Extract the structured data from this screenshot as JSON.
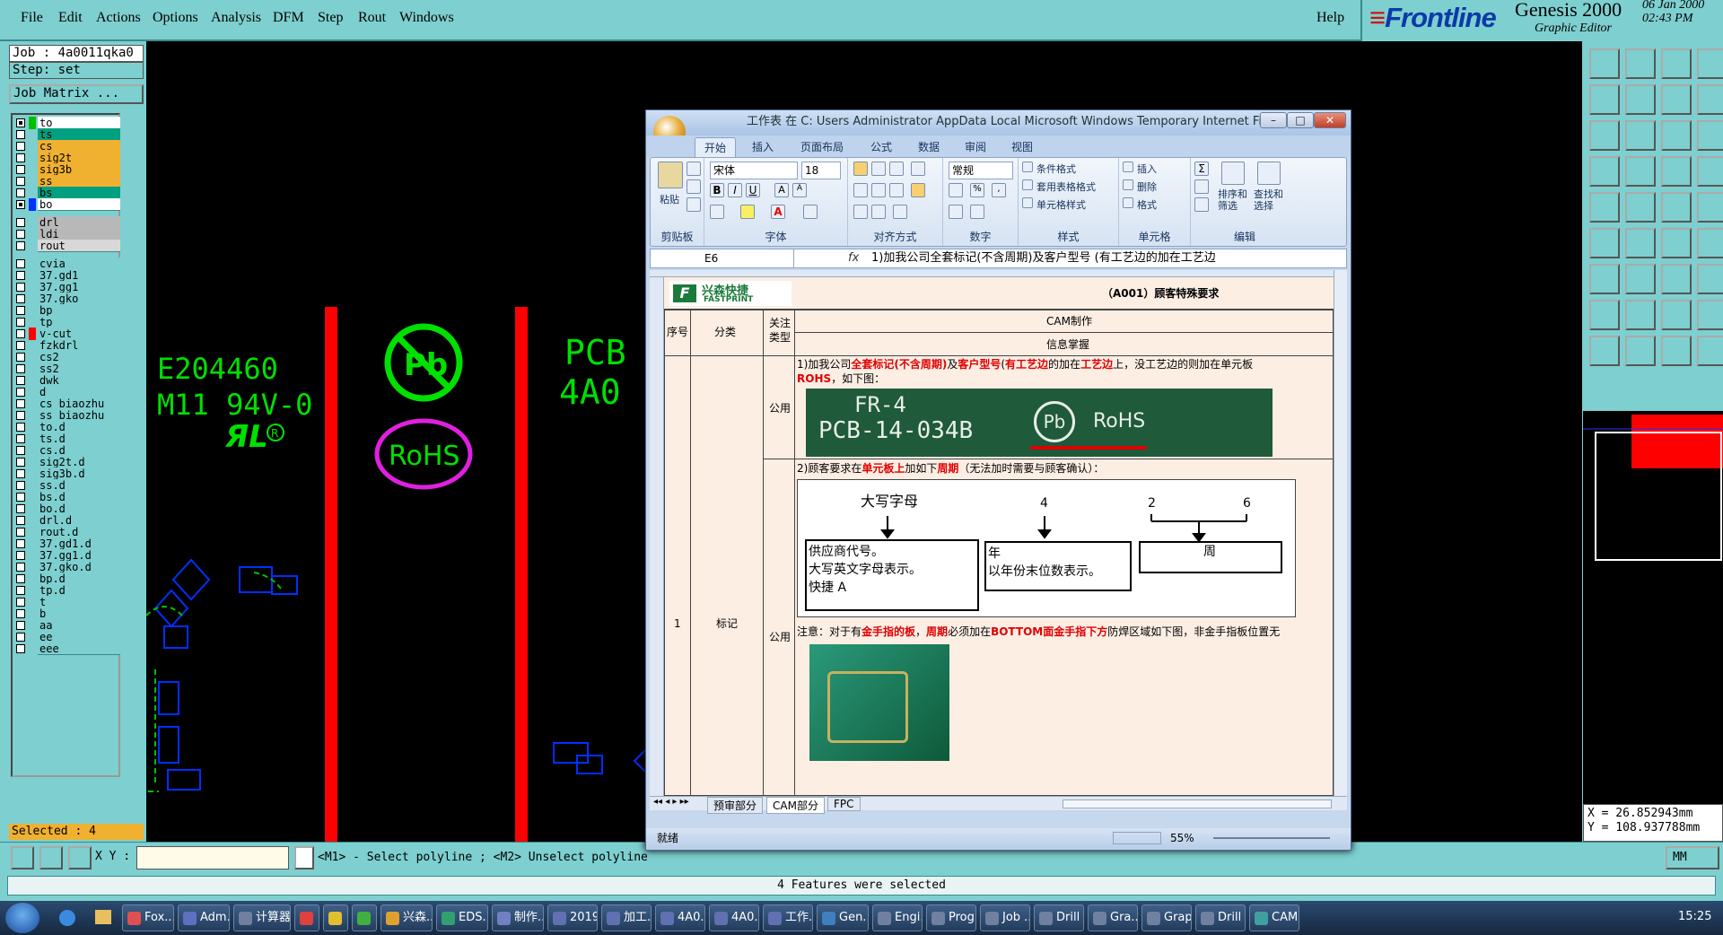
{
  "menubar": {
    "items": [
      "File",
      "Edit",
      "Actions",
      "Options",
      "Analysis",
      "DFM",
      "Step",
      "Rout",
      "Windows"
    ],
    "help": "Help"
  },
  "brand": {
    "logo": "Frontline",
    "product": "Genesis 2000",
    "subtitle": "Graphic Editor",
    "date": "06 Jan 2000",
    "time": "02:43 PM"
  },
  "job": {
    "job_line": "Job : 4a0011qka0",
    "step_line": "Step: set",
    "matrix_button": "Job Matrix ..."
  },
  "layers": [
    {
      "name": "to",
      "color": "#ffffff",
      "sw": "#00c000",
      "on": true
    },
    {
      "name": "ts",
      "color": "#00a080",
      "sw": "",
      "on": false
    },
    {
      "name": "cs",
      "color": "#f0b030",
      "sw": "",
      "on": false
    },
    {
      "name": "sig2t",
      "color": "#f0b030",
      "sw": "",
      "on": false
    },
    {
      "name": "sig3b",
      "color": "#f0b030",
      "sw": "",
      "on": false
    },
    {
      "name": "ss",
      "color": "#f0b030",
      "sw": "",
      "on": false
    },
    {
      "name": "bs",
      "color": "#00a080",
      "sw": "",
      "on": false
    },
    {
      "name": "bo",
      "color": "#ffffff",
      "sw": "#0030ff",
      "on": true
    },
    {
      "name": "drl",
      "color": "#b8b8b8",
      "sw": "",
      "on": false,
      "gap": true
    },
    {
      "name": "ldi",
      "color": "#b8b8b8",
      "sw": "",
      "on": false
    },
    {
      "name": "rout",
      "color": "#d8d8d8",
      "sw": "",
      "on": false
    },
    {
      "name": "cvia",
      "color": "#7ecfcf",
      "sw": "",
      "on": false,
      "gap": true
    },
    {
      "name": "37.gd1",
      "color": "#7ecfcf",
      "sw": "",
      "on": false
    },
    {
      "name": "37.gg1",
      "color": "#7ecfcf",
      "sw": "",
      "on": false
    },
    {
      "name": "37.gko",
      "color": "#7ecfcf",
      "sw": "",
      "on": false
    },
    {
      "name": "bp",
      "color": "#7ecfcf",
      "sw": "",
      "on": false
    },
    {
      "name": "tp",
      "color": "#7ecfcf",
      "sw": "",
      "on": false
    },
    {
      "name": "v-cut",
      "color": "#7ecfcf",
      "sw": "#ff0000",
      "on": false
    },
    {
      "name": "fzkdrl",
      "color": "#7ecfcf",
      "sw": "",
      "on": false
    },
    {
      "name": "cs2",
      "color": "#7ecfcf",
      "sw": "",
      "on": false
    },
    {
      "name": "ss2",
      "color": "#7ecfcf",
      "sw": "",
      "on": false
    },
    {
      "name": "dwk",
      "color": "#7ecfcf",
      "sw": "",
      "on": false
    },
    {
      "name": "d",
      "color": "#7ecfcf",
      "sw": "",
      "on": false
    },
    {
      "name": "cs_biaozhu",
      "color": "#7ecfcf",
      "sw": "",
      "on": false
    },
    {
      "name": "ss_biaozhu",
      "color": "#7ecfcf",
      "sw": "",
      "on": false
    },
    {
      "name": "to.d",
      "color": "#7ecfcf",
      "sw": "",
      "on": false
    },
    {
      "name": "ts.d",
      "color": "#7ecfcf",
      "sw": "",
      "on": false
    },
    {
      "name": "cs.d",
      "color": "#7ecfcf",
      "sw": "",
      "on": false
    },
    {
      "name": "sig2t.d",
      "color": "#7ecfcf",
      "sw": "",
      "on": false
    },
    {
      "name": "sig3b.d",
      "color": "#7ecfcf",
      "sw": "",
      "on": false
    },
    {
      "name": "ss.d",
      "color": "#7ecfcf",
      "sw": "",
      "on": false
    },
    {
      "name": "bs.d",
      "color": "#7ecfcf",
      "sw": "",
      "on": false
    },
    {
      "name": "bo.d",
      "color": "#7ecfcf",
      "sw": "",
      "on": false
    },
    {
      "name": "drl.d",
      "color": "#7ecfcf",
      "sw": "",
      "on": false
    },
    {
      "name": "rout.d",
      "color": "#7ecfcf",
      "sw": "",
      "on": false
    },
    {
      "name": "37.gd1.d",
      "color": "#7ecfcf",
      "sw": "",
      "on": false
    },
    {
      "name": "37.gg1.d",
      "color": "#7ecfcf",
      "sw": "",
      "on": false
    },
    {
      "name": "37.gko.d",
      "color": "#7ecfcf",
      "sw": "",
      "on": false
    },
    {
      "name": "bp.d",
      "color": "#7ecfcf",
      "sw": "",
      "on": false
    },
    {
      "name": "tp.d",
      "color": "#7ecfcf",
      "sw": "",
      "on": false
    },
    {
      "name": "t",
      "color": "#7ecfcf",
      "sw": "",
      "on": false
    },
    {
      "name": "b",
      "color": "#7ecfcf",
      "sw": "",
      "on": false
    },
    {
      "name": "aa",
      "color": "#7ecfcf",
      "sw": "",
      "on": false
    },
    {
      "name": "ee",
      "color": "#7ecfcf",
      "sw": "",
      "on": false
    },
    {
      "name": "eee",
      "color": "#7ecfcf",
      "sw": "",
      "on": false
    }
  ],
  "selected_count": "Selected : 4",
  "canvas": {
    "text_e": "E204460",
    "text_m": "M11 94V-0",
    "text_pcb": "PCB",
    "text_4a": "4A0",
    "rohs": "RoHS",
    "pb": "Pb",
    "ul_mark": "R"
  },
  "coords": {
    "x": "X = 26.852943mm",
    "y": "Y = 108.937788mm"
  },
  "units": "MM",
  "command": {
    "xy_label": "X Y :",
    "xy_value": "",
    "prompt": "<M1> - Select polyline ; <M2> Unselect polyline"
  },
  "status_message": "4 Features were selected",
  "excel": {
    "title": "工作表 在 C: Users Administrator AppData Local Microsoft Windows Temporary Internet Files...",
    "tabs": [
      "开始",
      "插入",
      "页面布局",
      "公式",
      "数据",
      "审阅",
      "视图"
    ],
    "clipboard": {
      "paste": "粘贴",
      "group": "剪贴板"
    },
    "font": {
      "name": "宋体",
      "size": "18",
      "group": "字体"
    },
    "align_group": "对齐方式",
    "number": {
      "format": "常规",
      "group": "数字"
    },
    "styles": {
      "cond": "条件格式",
      "table": "套用表格格式",
      "cell": "单元格样式",
      "group": "样式"
    },
    "cells": {
      "insert": "插入",
      "delete": "删除",
      "format": "格式",
      "group": "单元格"
    },
    "editing": {
      "sort": "排序和\n筛选",
      "find": "查找和\n选择",
      "group": "编辑"
    },
    "name_box": "E6",
    "fx": "fx",
    "formula": "1)加我公司全套标记(不含周期)及客户型号 (有工艺边的加在工艺边",
    "company": "兴森快捷",
    "company_en": "FASTPRINT",
    "sheet_title": "（A001）顾客特殊要求",
    "col_seq": "序号",
    "col_cat": "分类",
    "col_type": "关注类型",
    "col_cam": "CAM制作",
    "col_info": "信息掌握",
    "row_num": "1",
    "row_cat": "标记",
    "public": "公用",
    "text1_a": "1)加我公司",
    "text1_b": "全套标记(不含周期)",
    "text1_c": "及",
    "text1_d": "客户型号",
    "text1_e": "(",
    "text1_f": "有工艺边",
    "text1_g": "的加在",
    "text1_h": "工艺边",
    "text1_i": "上，没工艺边的则加在单元板",
    "text1_j": "ROHS",
    "text1_k": "，如下图：",
    "photo_line1": "FR-4",
    "photo_line2": "PCB-14-034B",
    "photo_pb": "Pb",
    "photo_rohs": "RoHS",
    "text2_a": "2)顾客要求在",
    "text2_b": "单元板上",
    "text2_c": "加如下",
    "text2_d": "周期",
    "text2_e": "（无法加时需要与顾客确认）：",
    "diag_a": "大写字母",
    "diag_4": "4",
    "diag_2": "2",
    "diag_6": "6",
    "diag_box1_l1": "供应商代号。",
    "diag_box1_l2": "大写英文字母表示。",
    "diag_box1_l3": "快捷 A",
    "diag_box2_l1": "年",
    "diag_box2_l2": "以年份末位数表示。",
    "diag_box3": "周",
    "note_a": "注意：对于有",
    "note_b": "金手指的板",
    "note_c": "，",
    "note_d": "周期",
    "note_e": "必须加在",
    "note_f": "BOTTOM面金手指下方",
    "note_g": "防焊区域如下图，非金手指板位置无",
    "sheet_tabs": [
      "预审部分",
      "CAM部分",
      "FPC"
    ],
    "status": "就绪",
    "zoom": "55%"
  },
  "taskbar": {
    "items": [
      "Fox...",
      "Adm...",
      "计算器",
      "",
      "",
      "",
      "兴森...",
      "EDS...",
      "制作...",
      "2019...",
      "加工...",
      "4A0...",
      "4A0...",
      "工作...",
      "Gen...",
      "Engi...",
      "Prog...",
      "Job ...",
      "Drill ...",
      "Gra...",
      "Grap...",
      "Drill ...",
      "CAM..."
    ],
    "clock": "15:25"
  }
}
